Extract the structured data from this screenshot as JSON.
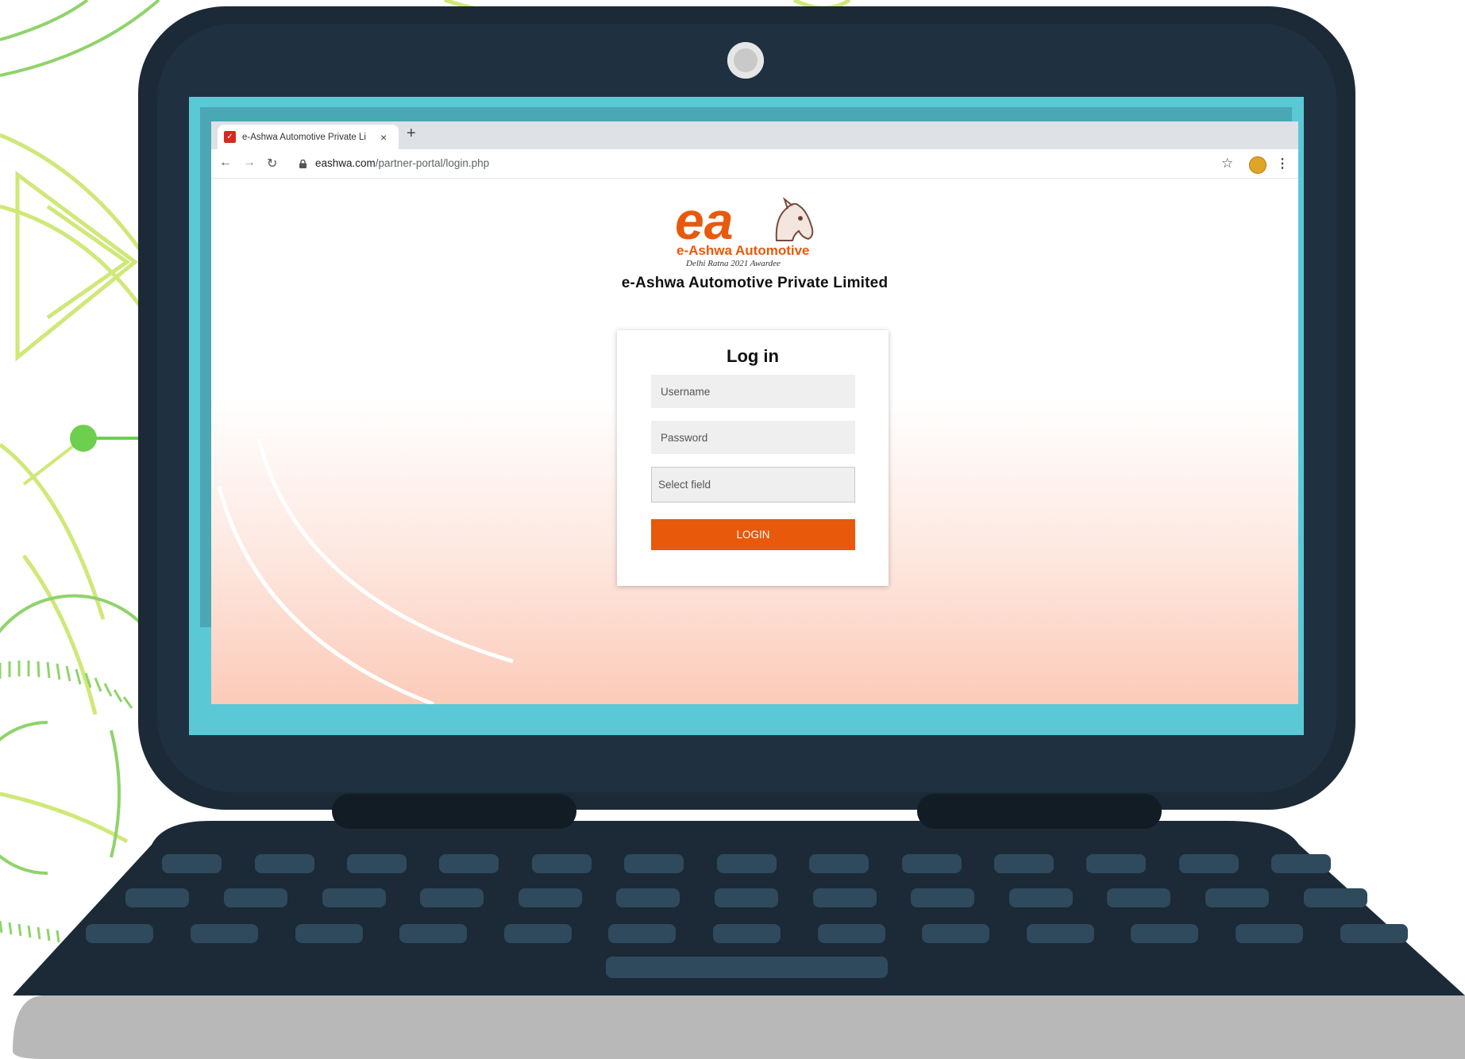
{
  "browser": {
    "tab_title": "e-Ashwa Automotive Private Li",
    "tab_close": "×",
    "new_tab": "+",
    "url_domain": "eashwa.com",
    "url_path": "/partner-portal/login.php",
    "nav_back": "←",
    "nav_forward": "→",
    "nav_reload": "↻",
    "bookmark": "☆",
    "menu": "⋮"
  },
  "logo": {
    "brand_line": "e-Ashwa Automotive",
    "tagline": "Delhi Ratna 2021 Awardee",
    "mark": "ea"
  },
  "page": {
    "company_name": "e-Ashwa Automotive Private Limited"
  },
  "login_form": {
    "title": "Log in",
    "username_placeholder": "Username",
    "password_placeholder": "Password",
    "select_placeholder": "Select field",
    "submit_label": "LOGIN"
  },
  "colors": {
    "brand_orange": "#e8590c",
    "laptop_body": "#1b2a36",
    "screen_bezel": "#5bc8d6",
    "deco_green": "#8fd36a"
  },
  "icons": [
    "lock-icon",
    "star-icon",
    "profile-icon",
    "kebab-menu-icon",
    "horse-icon"
  ]
}
